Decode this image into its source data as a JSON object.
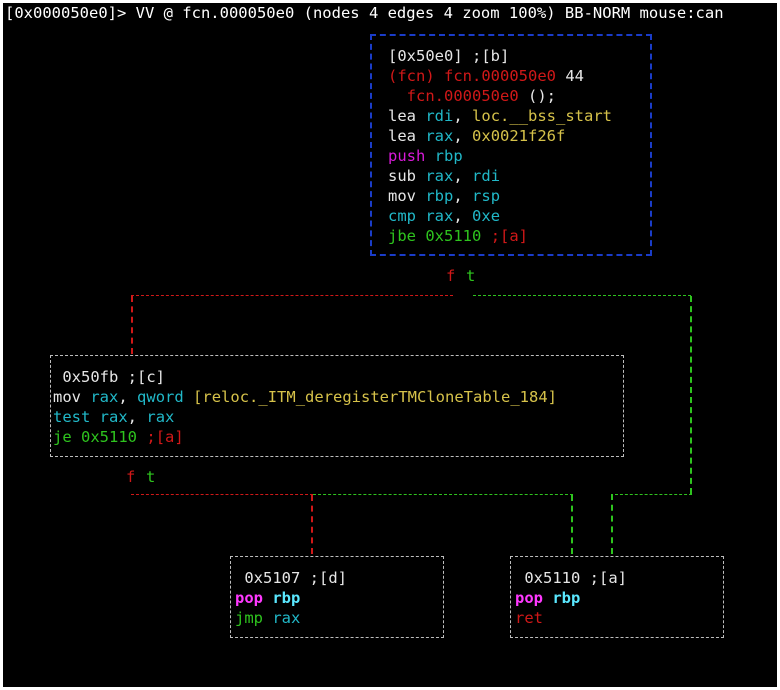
{
  "header": {
    "text": "[0x000050e0]> VV @ fcn.000050e0 (nodes 4 edges 4 zoom 100%) BB-NORM mouse:can"
  },
  "nodes": {
    "a": {
      "addr": "[0x50e0] ;[b]",
      "fcn_kw": "(fcn)",
      "fcn_name": "fcn.000050e0",
      "fcn_size": "44",
      "fcn_sig_name": "fcn.000050e0",
      "fcn_sig_args": "();",
      "lines": [
        {
          "op": "lea",
          "a1": "rdi",
          "sep": ",",
          "a2": "loc.__bss_start"
        },
        {
          "op": "lea",
          "a1": "rax",
          "sep": ",",
          "a2": "0x0021f26f"
        },
        {
          "op": "push",
          "a1": "rbp"
        },
        {
          "op": "sub",
          "a1": "rax",
          "sep": ",",
          "a2": "rdi"
        },
        {
          "op": "mov",
          "a1": "rbp",
          "sep": ",",
          "a2": "rsp"
        },
        {
          "op": "cmp",
          "a1": "rax",
          "sep": ",",
          "a2": "0xe"
        },
        {
          "op": "jbe",
          "a1": "0x5110",
          "a2": ";[a]"
        }
      ]
    },
    "c": {
      "addr": "0x50fb ;[c]",
      "lines": [
        {
          "op": "mov",
          "a1": "rax",
          "sep": ",",
          "a2": "qword",
          "a3": "[reloc._ITM_deregisterTMCloneTable_184]"
        },
        {
          "op": "test",
          "a1": "rax",
          "sep": ",",
          "a2": "rax"
        },
        {
          "op": "je",
          "a1": "0x5110",
          "a2": ";[a]"
        }
      ]
    },
    "d": {
      "addr": "0x5107 ;[d]",
      "lines": [
        {
          "op": "pop",
          "a1": "rbp"
        },
        {
          "op": "jmp",
          "a1": "rax"
        }
      ]
    },
    "e": {
      "addr": "0x5110 ;[a]",
      "lines": [
        {
          "op": "pop",
          "a1": "rbp"
        },
        {
          "op": "ret"
        }
      ]
    }
  },
  "edge_labels": {
    "f": "f",
    "t": "t"
  },
  "colors": {
    "background": "#000000",
    "node_border_focus": "#1a3cc8",
    "edge_false": "#d01818",
    "edge_true": "#2ec41e",
    "mnemonic": "#e6e6e6",
    "register": "#21b8c8",
    "address": "#2ec41e",
    "push_pop": "#d81ad8",
    "immediate": "#d6c24a"
  }
}
